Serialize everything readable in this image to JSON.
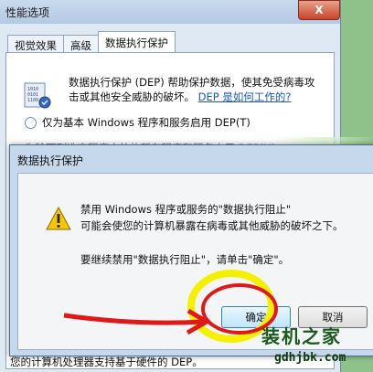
{
  "window": {
    "title": "性能选项",
    "close_label": "X",
    "tabs": [
      "视觉效果",
      "高级",
      "数据执行保护"
    ]
  },
  "dep_panel": {
    "description_part1": "数据执行保护 (DEP) 帮助保护数据，使其免受病毒攻击或其他安全威胁的破坏。",
    "link_text": "DEP 是如何工作的?",
    "option1_label": "仅为基本 Windows 程序和服务启用 DEP(T)",
    "partial_hidden_text": "为除下列选定程序之外的所有程序和服务启用 DEP(U):",
    "bottom_text": "您的计算机处理器支持基于硬件的 DEP。"
  },
  "dialog": {
    "title": "数据执行保护",
    "message_line1": "禁用 Windows 程序或服务的\"数据执行阻止\"",
    "message_line2": "可能会使您的计算机暴露在病毒或其他威胁的破坏之下。",
    "message_line3": "要继续禁用\"数据执行阻止\"，请单击\"确定\"。",
    "ok_label": "确定",
    "cancel_label": "取消"
  },
  "watermark": {
    "line1": "装机之家",
    "line2": "gdhjbk.com"
  },
  "colors": {
    "annotation_red": "#e01818",
    "annotation_yellow": "#f4f000"
  }
}
